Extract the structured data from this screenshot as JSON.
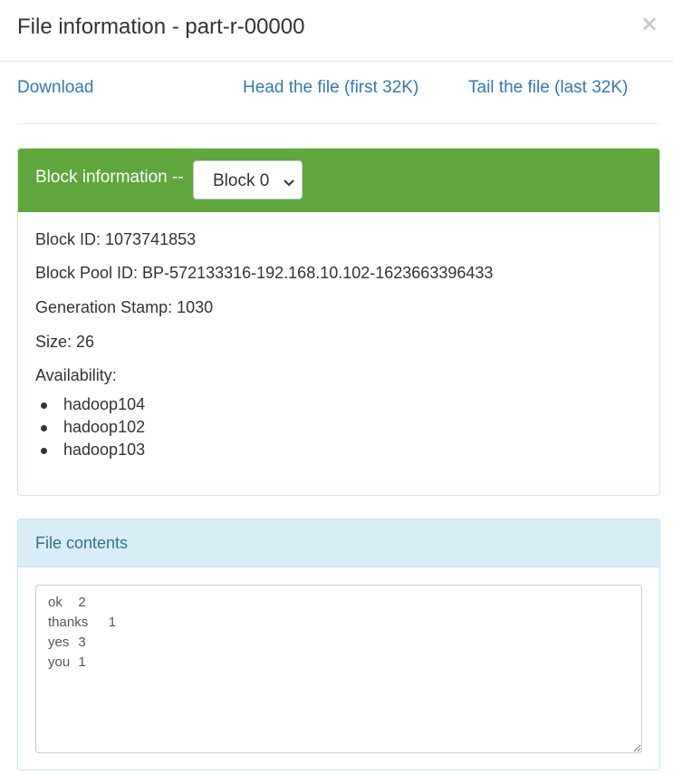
{
  "modal": {
    "title": "File information - part-r-00000",
    "close_label": "×"
  },
  "links": {
    "download": "Download",
    "head": "Head the file (first 32K)",
    "tail": "Tail the file (last 32K)"
  },
  "block_panel": {
    "heading": "Block information --",
    "selected_block": "Block 0",
    "block_id_label": "Block ID: 1073741853",
    "block_pool_label": "Block Pool ID: BP-572133316-192.168.10.102-1623663396433",
    "generation_label": "Generation Stamp: 1030",
    "size_label": "Size: 26",
    "availability_label": "Availability:",
    "availability": [
      "hadoop104",
      "hadoop102",
      "hadoop103"
    ]
  },
  "contents_panel": {
    "heading": "File contents",
    "text": "ok\t2\nthanks\t1\nyes\t3\nyou\t1"
  },
  "colors": {
    "success_heading": "#5fa63c",
    "info_heading_bg": "#d9edf7",
    "link": "#337ab7"
  }
}
